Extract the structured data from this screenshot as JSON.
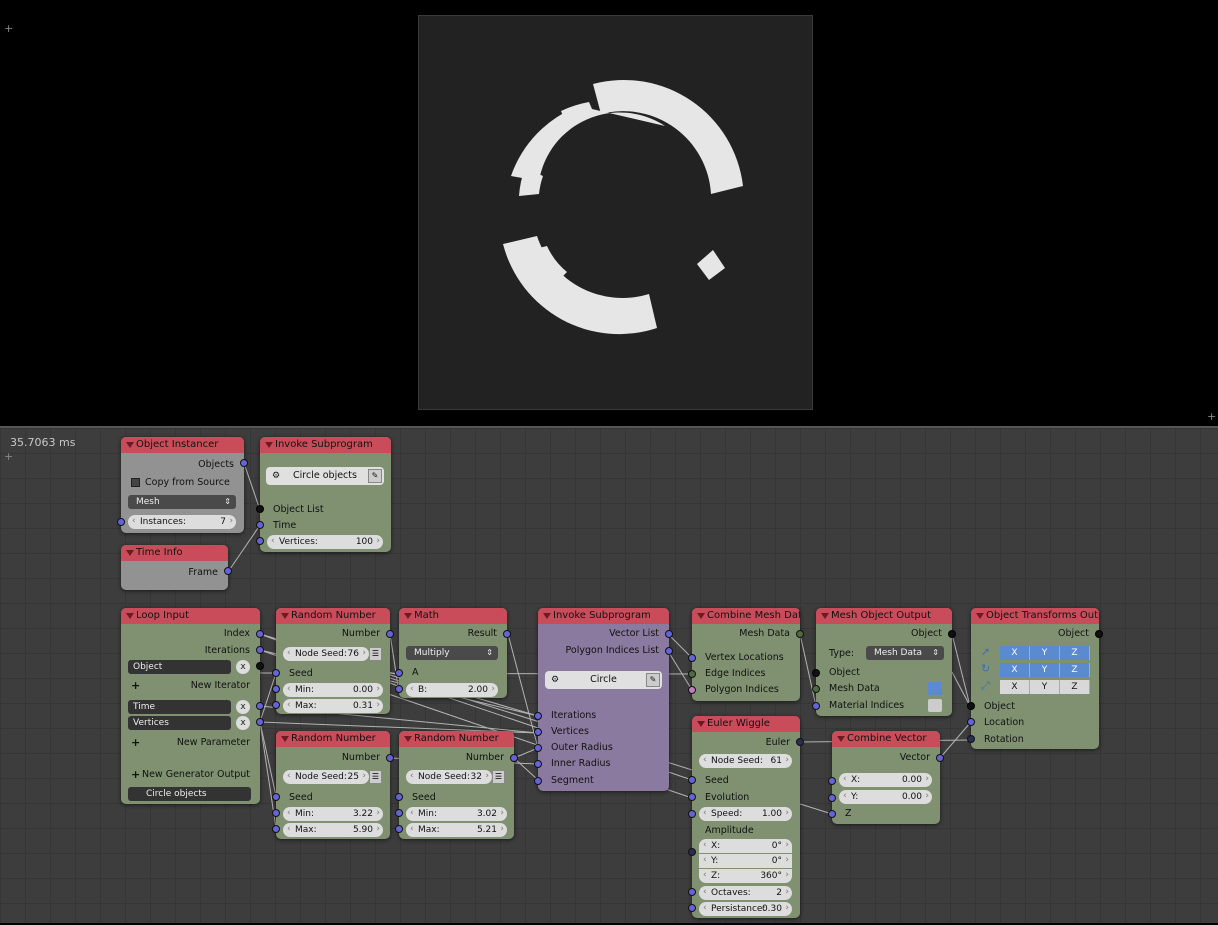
{
  "timing": "35.7063 ms",
  "icons": {
    "corner": "+",
    "plus": "+",
    "x": "x",
    "dropdown_arrow": "⇕"
  },
  "nodes": {
    "object_instancer": {
      "title": "Object Instancer",
      "out_objects": "Objects",
      "copy_from_source": "Copy from Source",
      "type": "Mesh",
      "instances_label": "Instances:",
      "instances_value": "7"
    },
    "invoke_top": {
      "title": "Invoke Subprogram",
      "subprogram": "Circle objects",
      "in_object_list": "Object List",
      "in_time": "Time",
      "vertices_label": "Vertices:",
      "vertices_value": "100"
    },
    "time_info": {
      "title": "Time Info",
      "out_frame": "Frame"
    },
    "loop_input": {
      "title": "Loop Input",
      "out_index": "Index",
      "out_iterations": "Iterations",
      "field_object": "Object",
      "new_iterator": "New Iterator",
      "field_time": "Time",
      "field_vertices": "Vertices",
      "new_parameter": "New Parameter",
      "new_generator": "New Generator Output",
      "loop_name": "Circle objects"
    },
    "random1": {
      "title": "Random Number",
      "out": "Number",
      "seed_label": "Node Seed:",
      "seed": "76",
      "in_seed": "Seed",
      "min_label": "Min:",
      "min": "0.00",
      "max_label": "Max:",
      "max": "0.31"
    },
    "math": {
      "title": "Math",
      "out": "Result",
      "op": "Multiply",
      "in_a": "A",
      "b_label": "B:",
      "b": "2.00"
    },
    "random2": {
      "title": "Random Number",
      "out": "Number",
      "seed_label": "Node Seed:",
      "seed": "25",
      "in_seed": "Seed",
      "min_label": "Min:",
      "min": "3.22",
      "max_label": "Max:",
      "max": "5.90"
    },
    "random3": {
      "title": "Random Number",
      "out": "Number",
      "seed_label": "Node Seed:",
      "seed": "32",
      "in_seed": "Seed",
      "min_label": "Min:",
      "min": "3.02",
      "max_label": "Max:",
      "max": "5.21"
    },
    "invoke_mid": {
      "title": "Invoke Subprogram",
      "out_vector": "Vector List",
      "out_poly": "Polygon Indices List",
      "subprogram": "Circle",
      "in_iterations": "Iterations",
      "in_vertices": "Vertices",
      "in_outer": "Outer Radius",
      "in_inner": "Inner Radius",
      "in_segment": "Segment"
    },
    "combine_mesh": {
      "title": "Combine Mesh Data",
      "out": "Mesh Data",
      "in_vertex": "Vertex Locations",
      "in_edge": "Edge Indices",
      "in_poly": "Polygon Indices"
    },
    "mesh_output": {
      "title": "Mesh Object Output",
      "out": "Object",
      "type_label": "Type:",
      "type": "Mesh Data",
      "in_object": "Object",
      "in_mesh": "Mesh Data",
      "in_material": "Material Indices"
    },
    "obj_transforms": {
      "title": "Object Transforms Outpu",
      "out": "Object",
      "x": "X",
      "y": "Y",
      "z": "Z",
      "in_object": "Object",
      "in_location": "Location",
      "in_rotation": "Rotation"
    },
    "euler_wiggle": {
      "title": "Euler Wiggle",
      "out": "Euler",
      "seed_label": "Node Seed:",
      "seed": "61",
      "in_seed": "Seed",
      "in_evolution": "Evolution",
      "speed_label": "Speed:",
      "speed": "1.00",
      "amplitude": "Amplitude",
      "ax_label": "X:",
      "ax": "0°",
      "ay_label": "Y:",
      "ay": "0°",
      "az_label": "Z:",
      "az": "360°",
      "oct_label": "Octaves:",
      "oct": "2",
      "pers_label": "Persistance:",
      "pers": "0.30"
    },
    "combine_vector": {
      "title": "Combine Vector",
      "out": "Vector",
      "x_label": "X:",
      "x": "0.00",
      "y_label": "Y:",
      "y": "0.00",
      "in_z": "Z"
    }
  }
}
